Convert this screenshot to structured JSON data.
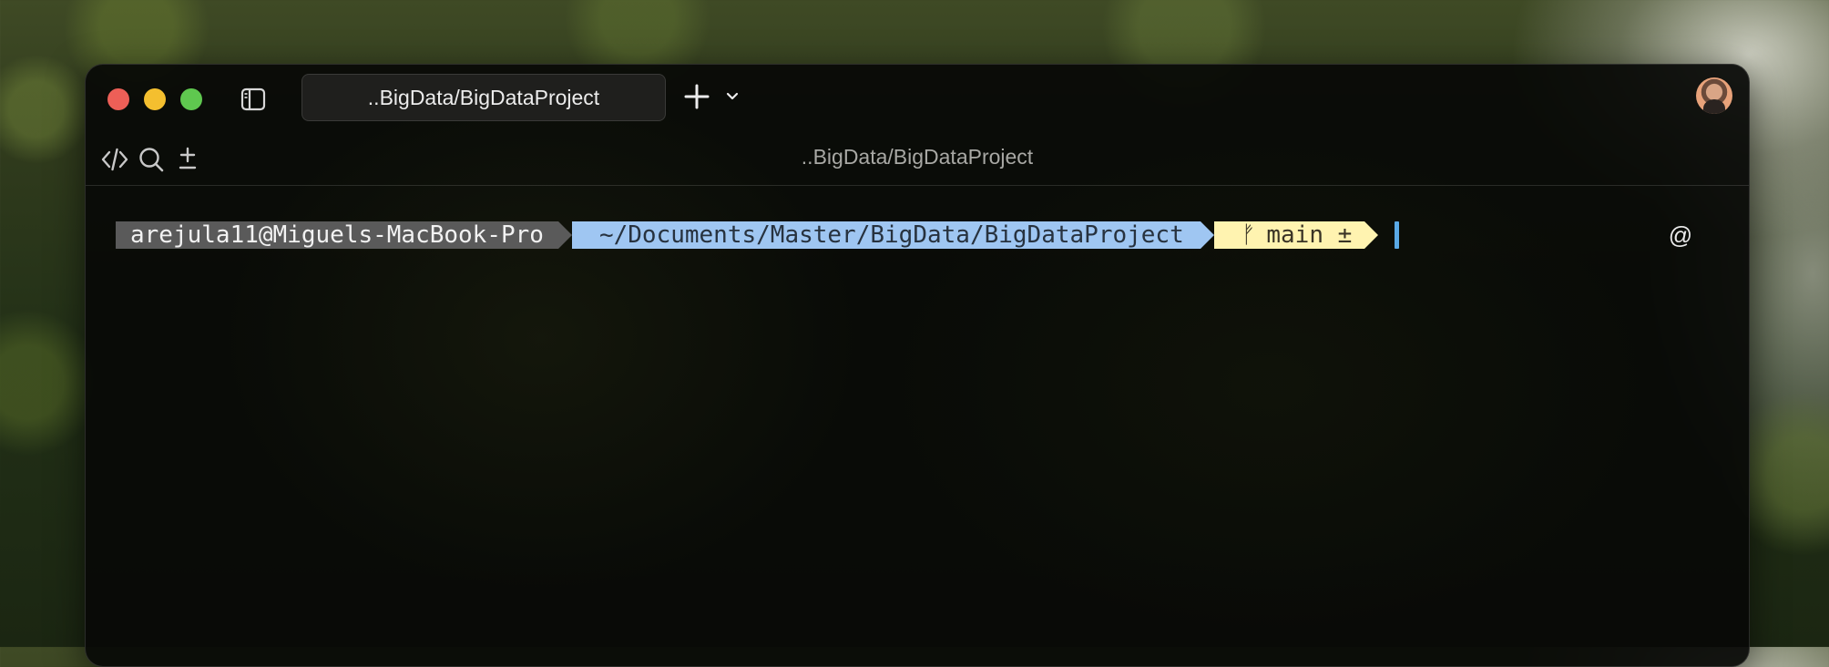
{
  "window": {
    "tab_title": "..BigData/BigDataProject",
    "path_label": "..BigData/BigDataProject"
  },
  "prompt": {
    "user_host": "arejula11@Miguels-MacBook-Pro",
    "cwd": "~/Documents/Master/BigData/BigDataProject",
    "git_branch_icon": "ᚠ",
    "git_branch": "main ±"
  },
  "right_action": "@",
  "icons": {
    "close": "close-traffic-light",
    "minimize": "minimize-traffic-light",
    "maximize": "maximize-traffic-light",
    "sidebar": "sidebar-icon",
    "new_tab": "plus-icon",
    "tab_dropdown": "chevron-down-icon",
    "code": "code-icon",
    "search": "search-icon",
    "diff": "plus-minus-icon",
    "at": "at-icon"
  },
  "colors": {
    "close": "#ed5f57",
    "minimize": "#f4bf2f",
    "maximize": "#5fc84f",
    "prompt_user_bg": "#5a5a5a",
    "prompt_path_bg": "#9fc6f2",
    "prompt_git_bg": "#fff3b0",
    "cursor": "#5aa9e6"
  }
}
